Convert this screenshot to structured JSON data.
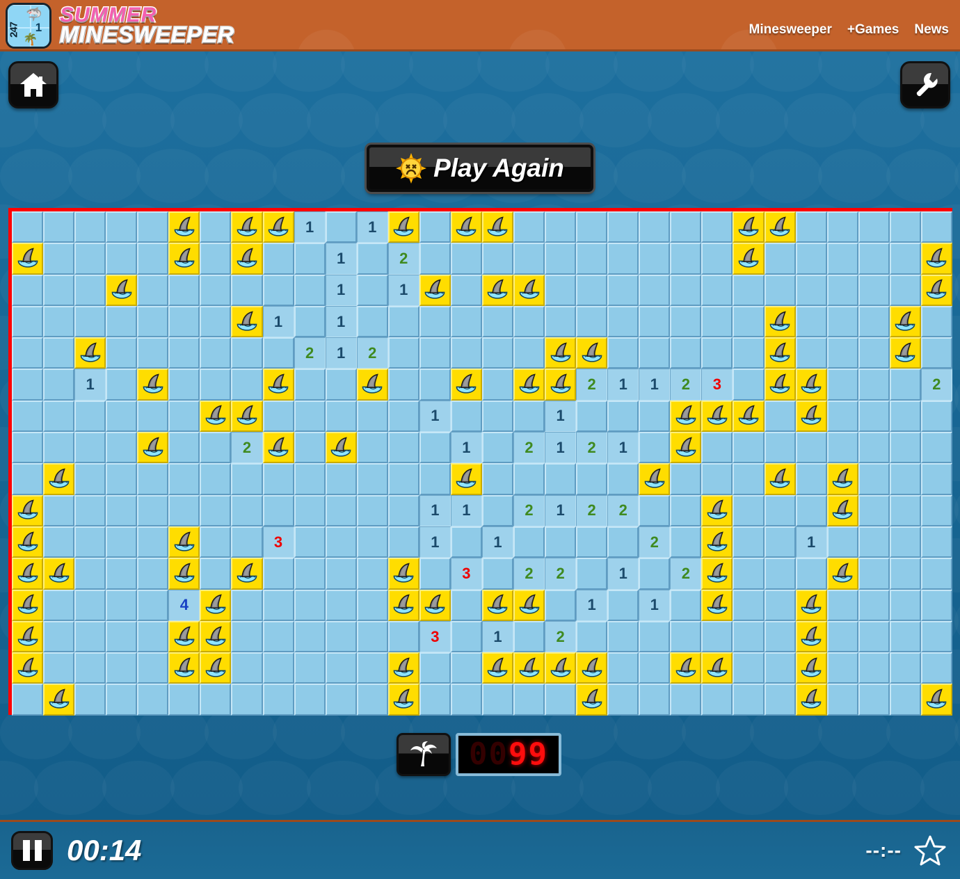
{
  "header": {
    "logo": {
      "tile_badge": "247",
      "tile_number": "1",
      "fin_icon": "shark-fin-icon",
      "palm_icon": "palm-tree-icon",
      "title_line1": "SUMMER",
      "title_line2": "MINESWEEPER"
    },
    "nav": [
      {
        "label": "Minesweeper",
        "name": "nav-minesweeper"
      },
      {
        "label": "+Games",
        "name": "nav-games"
      },
      {
        "label": "News",
        "name": "nav-news"
      }
    ]
  },
  "toolbar": {
    "home_icon": "home-icon",
    "settings_icon": "wrench-icon"
  },
  "game": {
    "play_again_label": "Play Again",
    "play_again_icon": "dead-sun-icon",
    "mine_counter_icon": "palm-tree-icon",
    "mine_counter_digits": [
      "0",
      "0",
      "9",
      "9"
    ],
    "mine_counter_active_from": 2,
    "pause_icon": "pause-icon",
    "elapsed_time": "00:14",
    "best_time": "--:--",
    "star_icon": "star-icon",
    "status": "lost",
    "border_color": "#ff0000",
    "colors": {
      "flag_cell": "#ffdd00",
      "covered_cell": "#8fcbe8",
      "open_cell": "#9ed2ec",
      "n1": "#1b4a6b",
      "n2": "#3f8a20",
      "n3": "#ee0000",
      "n4": "#1741c4"
    }
  },
  "board": {
    "cols": 30,
    "rows": 16,
    "legend": "'.'=covered, 'F'=flag/shark, '_'=open blank, digit=open number",
    "cells": [
      ".....F.FF1.1F.FF.......FF.......",
      "F....F.F..1.2..........F.....F..",
      "...F......1.1F.FF............F..",
      ".......F1.1.............F...F.F.",
      "..F......212.....FF.....F...F...",
      "..1.F...F..F..F.FF21123.FF...2.F",
      "......FF.....1...1...FFF.F....F.",
      "....F..2F.F...1.2121.F..........",
      ".F............F.....F...F.F.....",
      "F............11.2122..F...F....F",
      "F....F..3....1.1....2.F..1.....F",
      "FF...F.F....F.3.22.1.2F...F....F",
      "F....4F.....FF.FF.1.1.F..F.....F",
      "F....FF......3.1.2.......F.....F",
      "F....FF.....F..FFFF..FF..F.....F",
      ".F..........F.....F......F...F.."
    ]
  }
}
